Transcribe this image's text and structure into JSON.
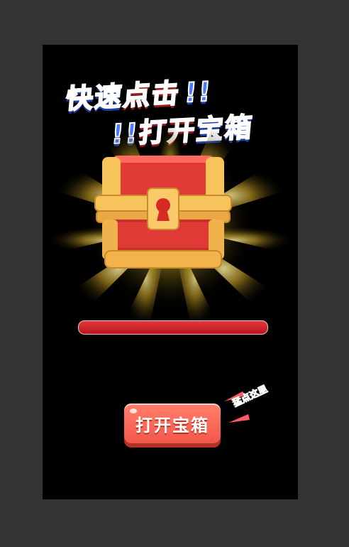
{
  "title": {
    "line1_blue": "快速",
    "line1_red": "点击",
    "line1_exclaim": "!!",
    "line2_exclaim": "!!",
    "line2_blue": "打开",
    "line2_red": "宝箱"
  },
  "progress": {
    "value": 0
  },
  "open_button": {
    "label": "打开宝箱"
  },
  "hint": {
    "text": "猛点这里"
  },
  "colors": {
    "background": "#333333",
    "phone_bg": "#000000",
    "title_blue": "#4b7bff",
    "title_red": "#ff4b4b",
    "bar": "#d4242b",
    "button": "#f2574c"
  }
}
